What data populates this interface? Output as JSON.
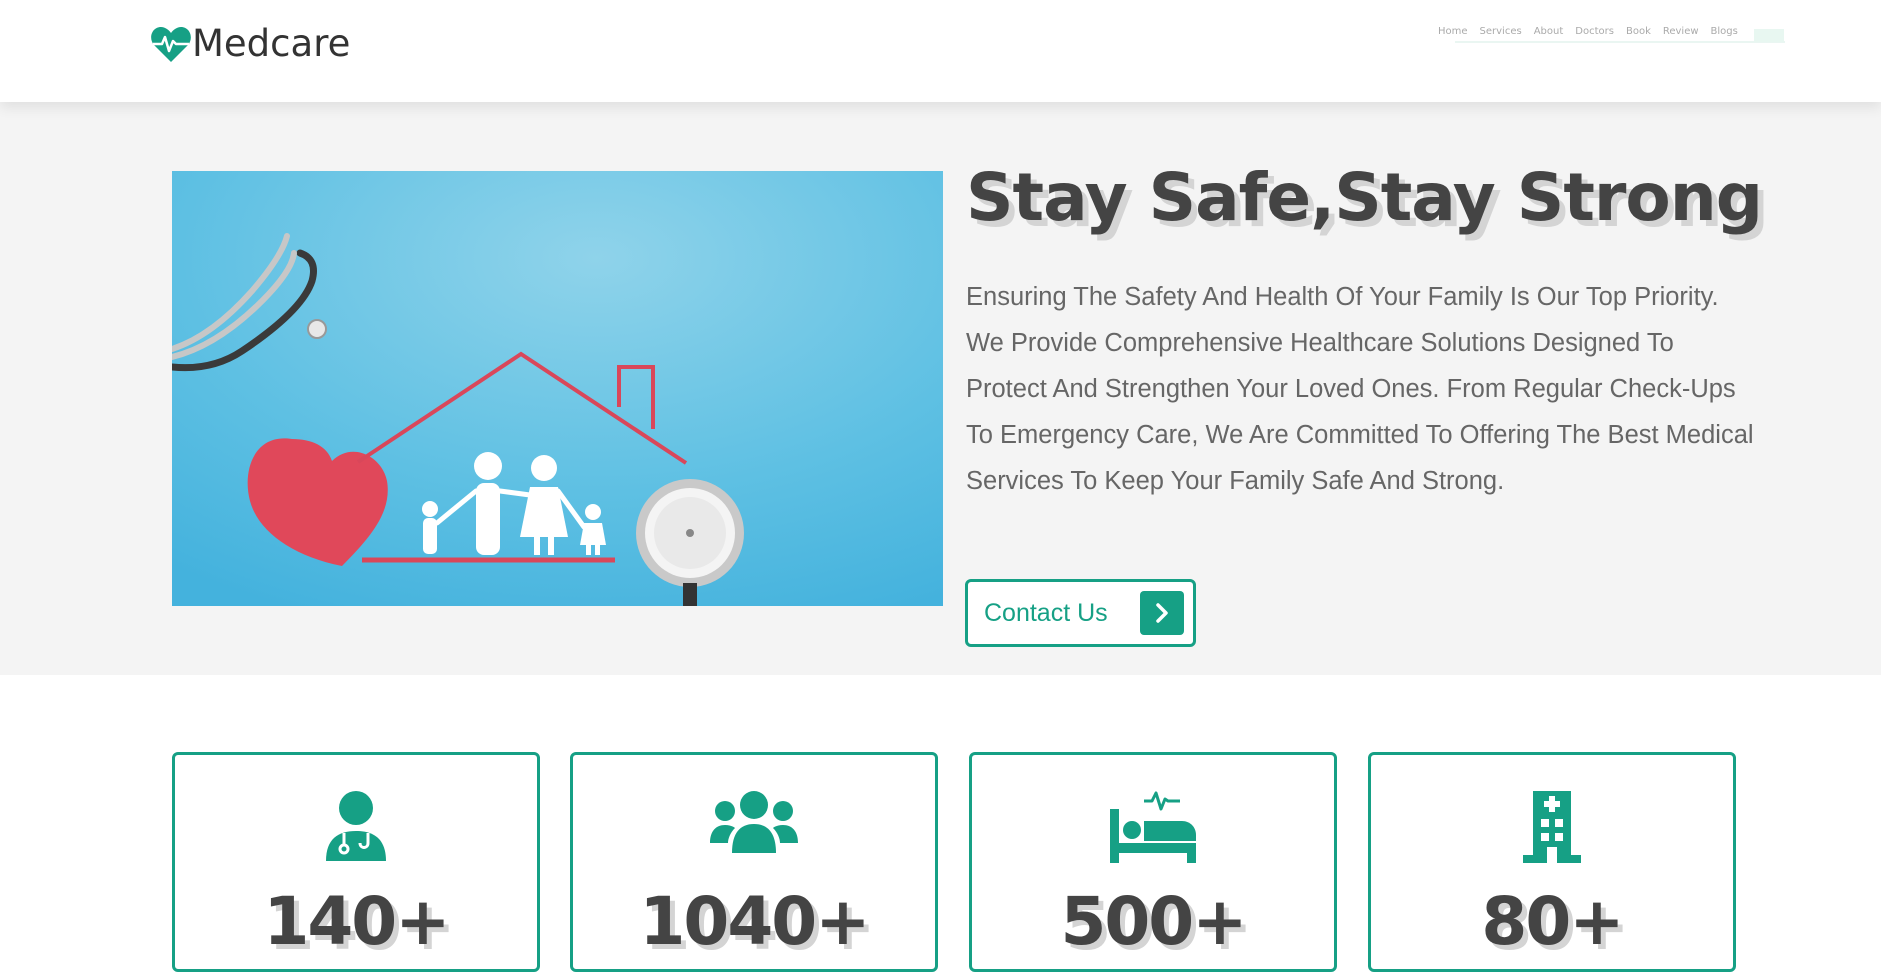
{
  "brand": {
    "name": "Medcare",
    "accent": "#16a085"
  },
  "nav": {
    "items": [
      "Home",
      "Services",
      "About",
      "Doctors",
      "Book",
      "Review",
      "Blogs"
    ]
  },
  "hero": {
    "title": "Stay Safe,Stay Strong",
    "text": "Ensuring The Safety And Health Of Your Family Is Our Top Priority. We Provide Comprehensive Healthcare Solutions Designed To Protect And Strengthen Your Loved Ones. From Regular Check-Ups To Emergency Care, We Are Committed To Offering The Best Medical Services To Keep Your Family Safe And Strong.",
    "button_label": "Contact Us"
  },
  "stats": [
    {
      "icon": "doctor-icon",
      "value": "140+"
    },
    {
      "icon": "patients-icon",
      "value": "1040+"
    },
    {
      "icon": "bed-icon",
      "value": "500+"
    },
    {
      "icon": "hospital-icon",
      "value": "80+"
    }
  ]
}
